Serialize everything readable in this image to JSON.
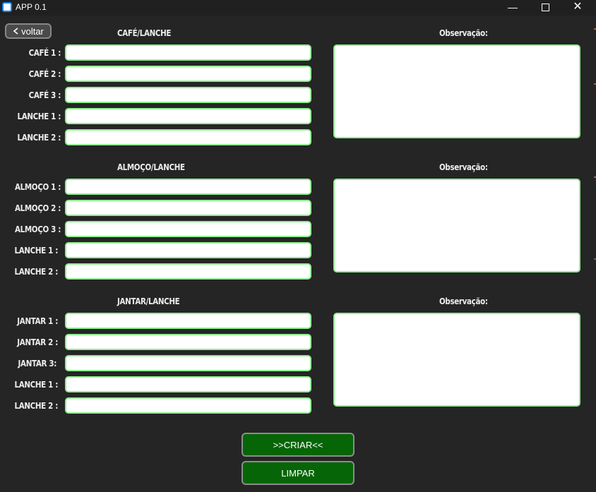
{
  "window": {
    "title": "APP 0.1",
    "minimize_glyph": "—",
    "close_glyph": "✕"
  },
  "back_button": {
    "label": "voltar",
    "icon": "chevron-left-icon"
  },
  "sections": [
    {
      "title": "CAFÉ/LANCHE",
      "observation_title": "Observação:",
      "fields": [
        {
          "label": "CAFÉ 1 :",
          "value": ""
        },
        {
          "label": "CAFÉ 2 :",
          "value": ""
        },
        {
          "label": "CAFÉ 3 :",
          "value": ""
        },
        {
          "label": "LANCHE 1 :",
          "value": ""
        },
        {
          "label": "LANCHE 2 :",
          "value": ""
        }
      ],
      "observation_value": ""
    },
    {
      "title": "ALMOÇO/LANCHE",
      "observation_title": "Observação:",
      "fields": [
        {
          "label": "ALMOÇO 1 :",
          "value": ""
        },
        {
          "label": "ALMOÇO 2 :",
          "value": ""
        },
        {
          "label": "ALMOÇO 3 :",
          "value": ""
        },
        {
          "label": "LANCHE 1 :",
          "value": ""
        },
        {
          "label": "LANCHE 2 :",
          "value": ""
        }
      ],
      "observation_value": ""
    },
    {
      "title": "JANTAR/LANCHE",
      "observation_title": "Observação:",
      "fields": [
        {
          "label": "JANTAR 1 :",
          "value": ""
        },
        {
          "label": "JANTAR 2 :",
          "value": ""
        },
        {
          "label": "JANTAR 3:",
          "value": ""
        },
        {
          "label": "LANCHE 1 :",
          "value": ""
        },
        {
          "label": "LANCHE 2 :",
          "value": ""
        }
      ],
      "observation_value": ""
    }
  ],
  "actions": {
    "create_label": ">>CRIAR<<",
    "clear_label": "LIMPAR"
  },
  "colors": {
    "background": "#252525",
    "input_border": "#90ee90",
    "button_green": "#066506"
  }
}
